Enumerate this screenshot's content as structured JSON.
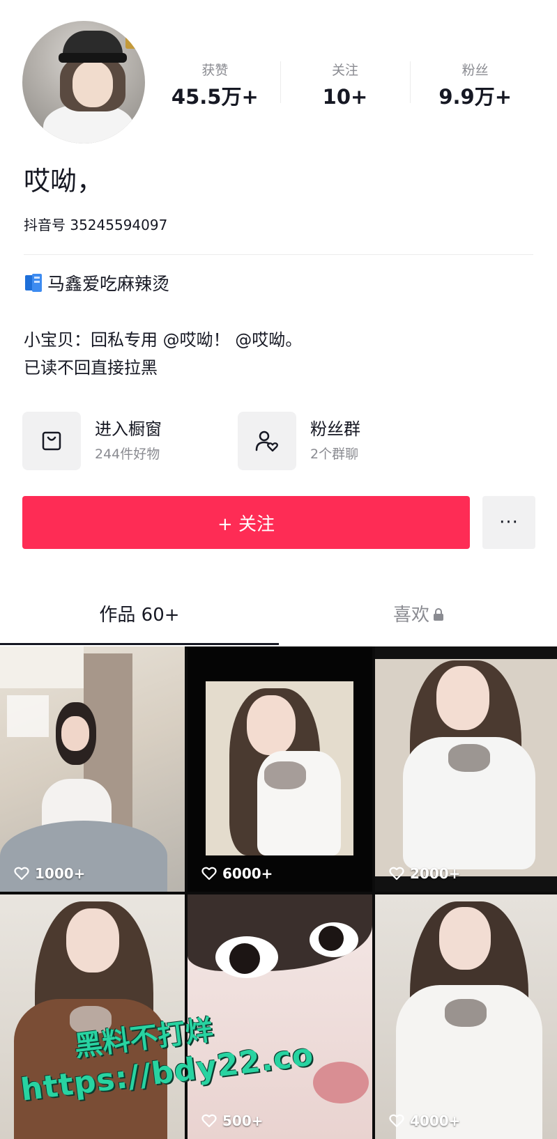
{
  "profile": {
    "nickname": "哎呦，",
    "douyin_id": "抖音号 35245594097",
    "link_text": "马鑫爱吃麻辣烫",
    "bio_line1": "小宝贝：回私专用 @哎呦！ @哎呦。",
    "bio_line2": "已读不回直接拉黑"
  },
  "stats": [
    {
      "label": "获赞",
      "value": "45.5万+"
    },
    {
      "label": "关注",
      "value": "10+"
    },
    {
      "label": "粉丝",
      "value": "9.9万+"
    }
  ],
  "cards": {
    "shop": {
      "title": "进入橱窗",
      "sub": "244件好物"
    },
    "fans": {
      "title": "粉丝群",
      "sub": "2个群聊"
    }
  },
  "actions": {
    "follow_label": "+ 关注",
    "more_label": "···"
  },
  "tabs": {
    "works": "作品 60+",
    "likes": "喜欢"
  },
  "videos": [
    {
      "likes": "1000+"
    },
    {
      "likes": "6000+"
    },
    {
      "likes": "2000+"
    },
    {
      "likes": ""
    },
    {
      "likes": "500+"
    },
    {
      "likes": "4000+"
    }
  ],
  "watermark": {
    "line1": "黑料不打烊",
    "line2": "https://bdy22.co"
  },
  "colors": {
    "accent": "#fe2c55",
    "text": "#161823",
    "muted": "#8a8b91",
    "watermark": "#28d3a1"
  }
}
